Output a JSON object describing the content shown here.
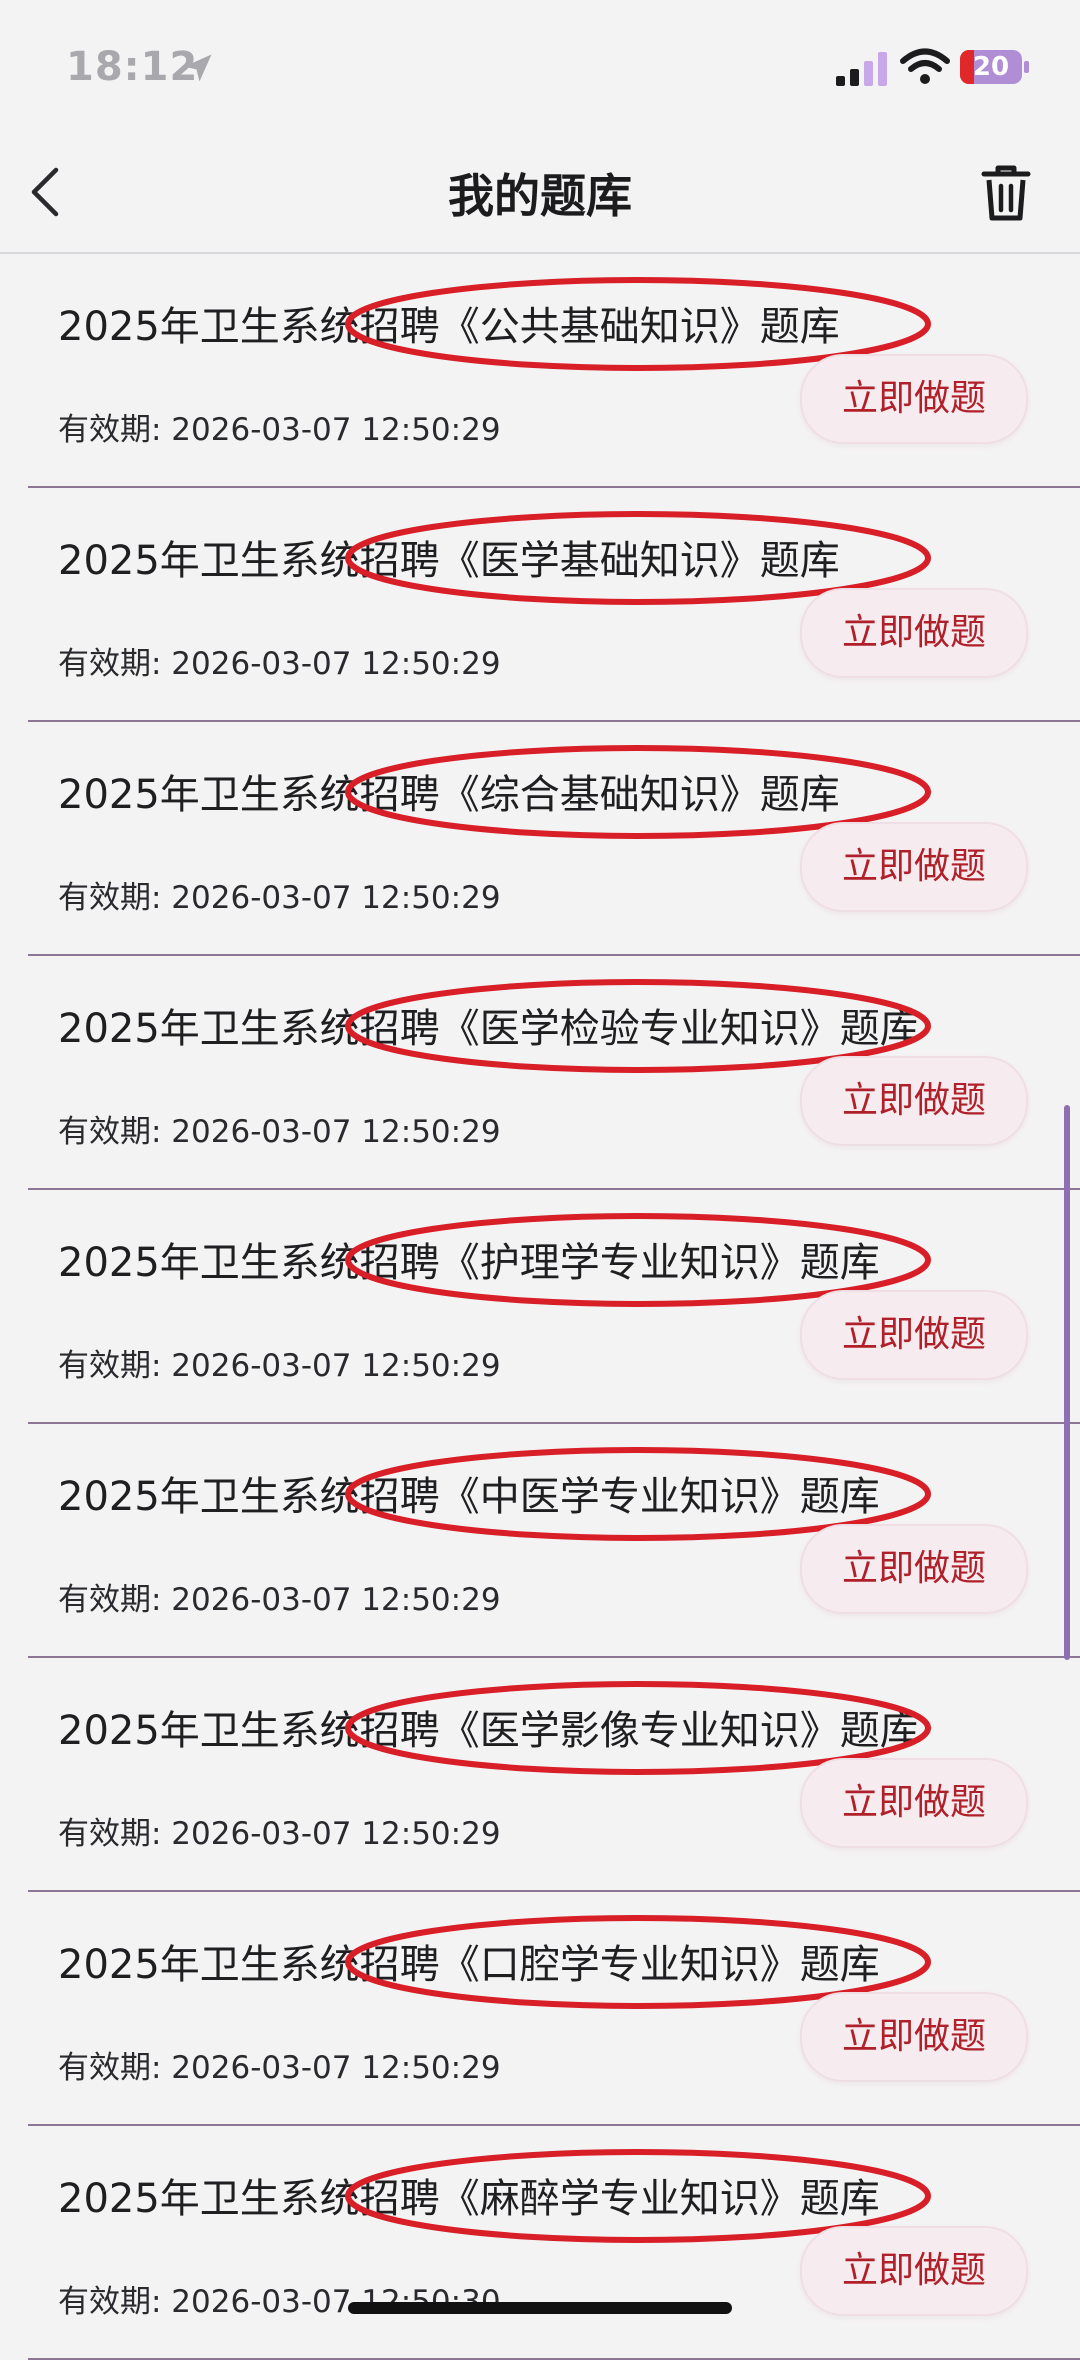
{
  "status_bar": {
    "time": "18:12",
    "battery_level": "20",
    "icons": [
      "location-arrow-icon",
      "signal-icon",
      "wifi-icon",
      "battery-icon"
    ]
  },
  "nav": {
    "title": "我的题库",
    "back_icon": "chevron-left-icon",
    "delete_icon": "trash-icon"
  },
  "colors": {
    "accent_button_text": "#b0202a",
    "highlight_ring": "#d81e26",
    "divider": "#8c7896",
    "scrollbar": "#8d6fb2"
  },
  "items": [
    {
      "title": "2025年卫生系统招聘《公共基础知识》题库",
      "expiry": "有效期: 2026-03-07 12:50:29",
      "button": "立即做题"
    },
    {
      "title": "2025年卫生系统招聘《医学基础知识》题库",
      "expiry": "有效期: 2026-03-07 12:50:29",
      "button": "立即做题"
    },
    {
      "title": "2025年卫生系统招聘《综合基础知识》题库",
      "expiry": "有效期: 2026-03-07 12:50:29",
      "button": "立即做题"
    },
    {
      "title": "2025年卫生系统招聘《医学检验专业知识》题库",
      "expiry": "有效期: 2026-03-07 12:50:29",
      "button": "立即做题"
    },
    {
      "title": "2025年卫生系统招聘《护理学专业知识》题库",
      "expiry": "有效期: 2026-03-07 12:50:29",
      "button": "立即做题"
    },
    {
      "title": "2025年卫生系统招聘《中医学专业知识》题库",
      "expiry": "有效期: 2026-03-07 12:50:29",
      "button": "立即做题"
    },
    {
      "title": "2025年卫生系统招聘《医学影像专业知识》题库",
      "expiry": "有效期: 2026-03-07 12:50:29",
      "button": "立即做题"
    },
    {
      "title": "2025年卫生系统招聘《口腔学专业知识》题库",
      "expiry": "有效期: 2026-03-07 12:50:29",
      "button": "立即做题"
    },
    {
      "title": "2025年卫生系统招聘《麻醉学专业知识》题库",
      "expiry": "有效期: 2026-03-07 12:50:30",
      "button": "立即做题"
    }
  ]
}
